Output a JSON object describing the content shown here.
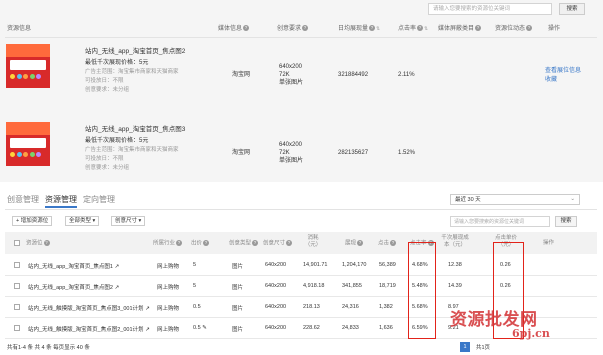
{
  "top": {
    "search_placeholder": "请输入您要搜索的资源位关键词",
    "search_button": "搜索",
    "headers": {
      "resource": "资源信息",
      "media": "媒体信息",
      "creative": "创意要求",
      "daily_pv": "日均展现量",
      "ctr": "点击率",
      "screen": "媒体屏蔽类目",
      "location": "资源位动态",
      "action": "操作"
    },
    "rows": [
      {
        "title": "站内_无线_app_淘宝首页_焦点图2",
        "price": "最低千次展现价格：5元",
        "audience": "广告主范围：淘宝集市商家和天猫商家",
        "recommend": "可投放日：不限",
        "group": "创意要求：未分组",
        "media": "淘宝网",
        "size": "640x200",
        "kb": "72K",
        "format": "单张图片",
        "pv": "321884492",
        "ctr": "2.11%",
        "action_view": "查看展位信息",
        "action_fav": "收藏"
      },
      {
        "title": "站内_无线_app_淘宝首页_焦点图3",
        "price": "最低千次展现价格：5元",
        "audience": "广告主范围：淘宝集市商家和天猫商家",
        "recommend": "可投放日：不限",
        "group": "创意要求：未分组",
        "media": "淘宝网",
        "size": "640x200",
        "kb": "72K",
        "format": "单张图片",
        "pv": "282135627",
        "ctr": "1.52%",
        "action_view": "",
        "action_fav": ""
      }
    ]
  },
  "bottom": {
    "tabs": [
      "创意管理",
      "资源管理",
      "定向管理"
    ],
    "range": "最近 30 天",
    "toolbar": {
      "add": "增加资源位",
      "all_types": "全部类型",
      "size": "创意尺寸"
    },
    "search_placeholder": "请输入您要搜索的资源位关键词",
    "search_button": "搜索",
    "columns": {
      "name": "资源位",
      "industry": "所属行业",
      "bid": "出价",
      "type": "创意类型",
      "size": "创意尺寸",
      "cost": "消耗（元）",
      "pv": "展现",
      "click": "点击",
      "ctr": "点击率",
      "cpm": "千次展现成本（元）",
      "cpc": "点击单价（元）",
      "op": "操作"
    },
    "rows": [
      {
        "name": "站内_无线_app_淘宝首页_焦点图1",
        "industry": "网上购物",
        "bid": "5",
        "type": "图片",
        "size": "640x200",
        "cost": "14,901.71",
        "pv": "1,204,170",
        "click": "56,389",
        "ctr": "4.68%",
        "cpm": "12.38",
        "cpc": "0.26"
      },
      {
        "name": "站内_无线_app_淘宝首页_焦点图2",
        "industry": "网上购物",
        "bid": "5",
        "type": "图片",
        "size": "640x200",
        "cost": "4,918.18",
        "pv": "341,855",
        "click": "18,719",
        "ctr": "5.48%",
        "cpm": "14.39",
        "cpc": "0.26"
      },
      {
        "name": "站内_无线_触摸版_淘宝首页_焦点图3_001计划",
        "industry": "网上购物",
        "bid": "0.5",
        "type": "图片",
        "size": "640x200",
        "cost": "218.13",
        "pv": "24,316",
        "click": "1,382",
        "ctr": "5.68%",
        "cpm": "8.97",
        "cpc": ""
      },
      {
        "name": "站内_无线_触摸版_淘宝首页_焦点图2_001计划",
        "industry": "网上购物",
        "bid": "0.5",
        "type": "图片",
        "size": "640x200",
        "cost": "228.62",
        "pv": "24,833",
        "click": "1,636",
        "ctr": "6.59%",
        "cpm": "9.21",
        "cpc": ""
      }
    ],
    "pager_left": "共有1-4 条  共 4 条  每页显示  40  条",
    "pager_page": "1",
    "pager_right": "共1页"
  },
  "watermark": "资源批发网",
  "watermark_url": "6pj.cn"
}
